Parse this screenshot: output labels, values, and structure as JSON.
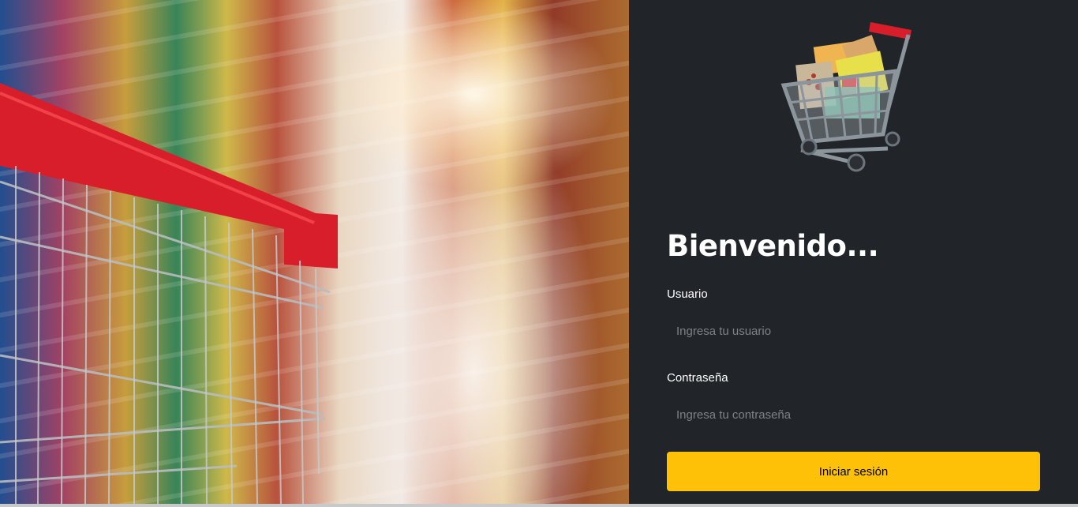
{
  "hero": {
    "image": "supermarket-aisle-with-shopping-cart"
  },
  "login": {
    "logo_icon": "shopping-cart-with-groceries-icon",
    "title": "Bienvenido...",
    "user_label": "Usuario",
    "user_placeholder": "Ingresa tu usuario",
    "password_label": "Contraseña",
    "password_placeholder": "Ingresa tu contraseña",
    "submit_label": "Iniciar sesión"
  },
  "colors": {
    "panel_bg": "#212529",
    "accent": "#ffc107",
    "text": "#ffffff",
    "placeholder": "#7d8288"
  }
}
